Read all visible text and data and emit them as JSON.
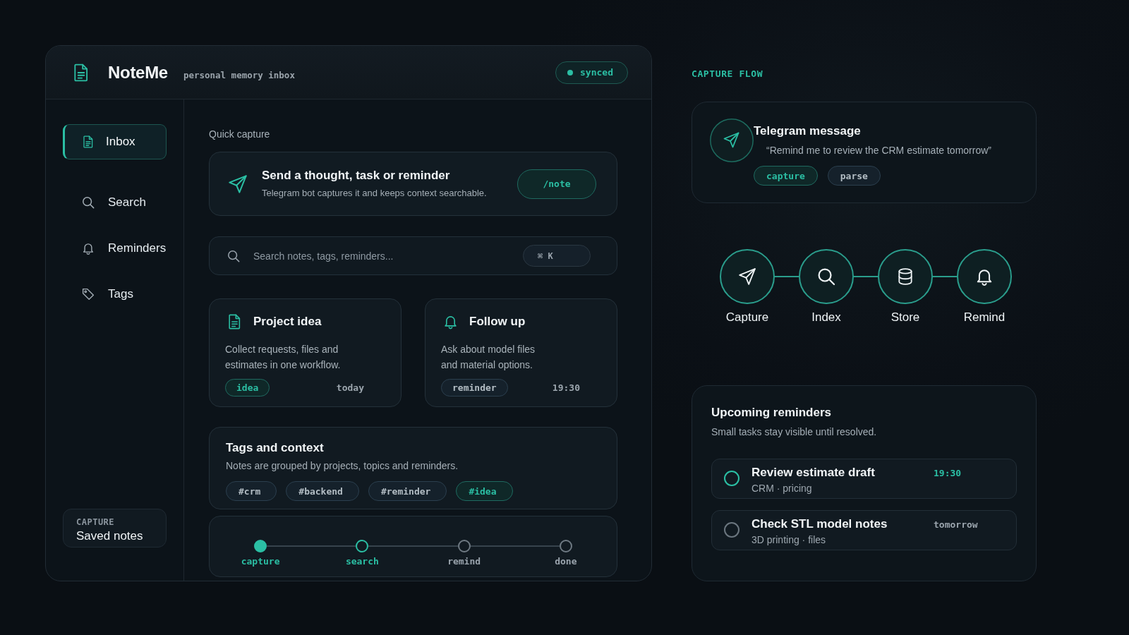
{
  "header": {
    "title": "NoteMe",
    "subtitle": "personal memory inbox",
    "status": "synced"
  },
  "sidebar": {
    "items": [
      {
        "label": "Inbox",
        "selected": true
      },
      {
        "label": "Search",
        "selected": false
      },
      {
        "label": "Reminders",
        "selected": false
      },
      {
        "label": "Tags",
        "selected": false
      }
    ],
    "footer": {
      "caption": "CAPTURE",
      "title": "Saved notes"
    }
  },
  "main": {
    "section_label": "Quick capture",
    "capture": {
      "title": "Send a thought, task or reminder",
      "description": "Telegram bot captures it and keeps context searchable.",
      "command": "/note"
    },
    "search": {
      "placeholder": "Search notes, tags, reminders...",
      "shortcut": "⌘ K"
    },
    "notes": [
      {
        "title": "Project idea",
        "body": "Collect requests, files and\nestimates in one workflow.",
        "tag": {
          "label": "idea",
          "highlighted": true
        },
        "time": "today"
      },
      {
        "title": "Follow up",
        "body": "Ask about model files\nand material options.",
        "tag": {
          "label": "reminder",
          "highlighted": false
        },
        "time": "19:30"
      }
    ],
    "tags": {
      "title": "Tags and context",
      "description": "Notes are grouped by projects, topics and reminders.",
      "items": [
        {
          "label": "#crm",
          "selected": false
        },
        {
          "label": "#backend",
          "selected": false
        },
        {
          "label": "#reminder",
          "selected": false
        },
        {
          "label": "#idea",
          "selected": true
        }
      ]
    },
    "progress": {
      "steps": [
        {
          "label": "capture",
          "selected": false
        },
        {
          "label": "search",
          "selected": true
        },
        {
          "label": "remind",
          "selected": false
        },
        {
          "label": "done",
          "selected": false
        }
      ]
    }
  },
  "capture_flow": {
    "heading": "CAPTURE FLOW",
    "message": {
      "title": "Telegram message",
      "quote": "“Remind me to review the CRM estimate tomorrow”",
      "tags": [
        {
          "label": "capture",
          "highlighted": true
        },
        {
          "label": "parse",
          "highlighted": false
        }
      ]
    },
    "stages": [
      "Capture",
      "Index",
      "Store",
      "Remind"
    ]
  },
  "reminders": {
    "title": "Upcoming reminders",
    "description": "Small tasks stay visible until resolved.",
    "items": [
      {
        "title": "Review estimate draft",
        "meta": "CRM · pricing",
        "time": "19:30",
        "highlighted": true
      },
      {
        "title": "Check STL model notes",
        "meta": "3D printing · files",
        "time": "tomorrow",
        "highlighted": false
      }
    ]
  }
}
